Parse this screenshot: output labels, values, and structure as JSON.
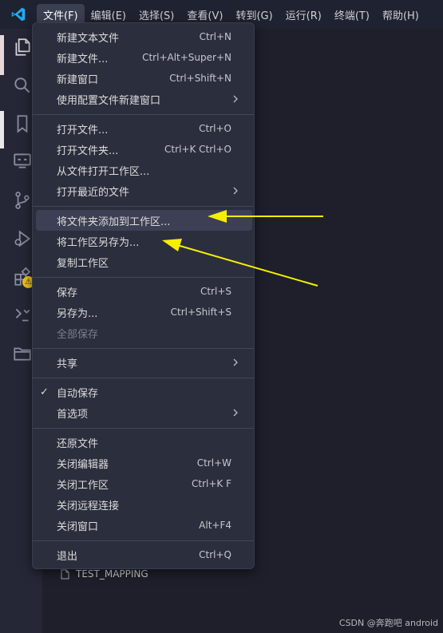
{
  "menubar": {
    "items": [
      {
        "label": "文件(F)"
      },
      {
        "label": "编辑(E)"
      },
      {
        "label": "选择(S)"
      },
      {
        "label": "查看(V)"
      },
      {
        "label": "转到(G)"
      },
      {
        "label": "运行(R)"
      },
      {
        "label": "终端(T)"
      },
      {
        "label": "帮助(H)"
      }
    ]
  },
  "file_menu": {
    "items": [
      {
        "label": "新建文本文件",
        "shortcut": "Ctrl+N"
      },
      {
        "label": "新建文件...",
        "shortcut": "Ctrl+Alt+Super+N"
      },
      {
        "label": "新建窗口",
        "shortcut": "Ctrl+Shift+N"
      },
      {
        "label": "使用配置文件新建窗口",
        "submenu": true
      },
      {
        "label": "打开文件...",
        "shortcut": "Ctrl+O"
      },
      {
        "label": "打开文件夹...",
        "shortcut": "Ctrl+K Ctrl+O"
      },
      {
        "label": "从文件打开工作区..."
      },
      {
        "label": "打开最近的文件",
        "submenu": true
      },
      {
        "label": "将文件夹添加到工作区..."
      },
      {
        "label": "将工作区另存为..."
      },
      {
        "label": "复制工作区"
      },
      {
        "label": "保存",
        "shortcut": "Ctrl+S"
      },
      {
        "label": "另存为...",
        "shortcut": "Ctrl+Shift+S"
      },
      {
        "label": "全部保存",
        "disabled": true
      },
      {
        "label": "共享",
        "submenu": true
      },
      {
        "label": "自动保存",
        "checked": true
      },
      {
        "label": "首选项",
        "submenu": true
      },
      {
        "label": "还原文件"
      },
      {
        "label": "关闭编辑器",
        "shortcut": "Ctrl+W"
      },
      {
        "label": "关闭工作区",
        "shortcut": "Ctrl+K F"
      },
      {
        "label": "关闭远程连接"
      },
      {
        "label": "关闭窗口",
        "shortcut": "Alt+F4"
      },
      {
        "label": "退出",
        "shortcut": "Ctrl+Q"
      }
    ],
    "check_mark": "✓"
  },
  "explorer": {
    "file_name": "TEST_MAPPING"
  },
  "watermark": "CSDN @奔跑吧 android",
  "activity_icons": [
    "explorer-icon",
    "search-icon",
    "bookmark-icon",
    "remote-explorer-icon",
    "source-control-icon",
    "run-debug-icon",
    "extensions-icon",
    "testing-icon",
    "folder-icon"
  ],
  "colors": {
    "accent_logo": "#23a9f2",
    "annotation_arrow": "#f5f000",
    "menu_bg": "#2b2e3d",
    "hover_bg": "#3d4054",
    "warning_badge": "#f0c21b"
  },
  "warning_badge": "⚠"
}
